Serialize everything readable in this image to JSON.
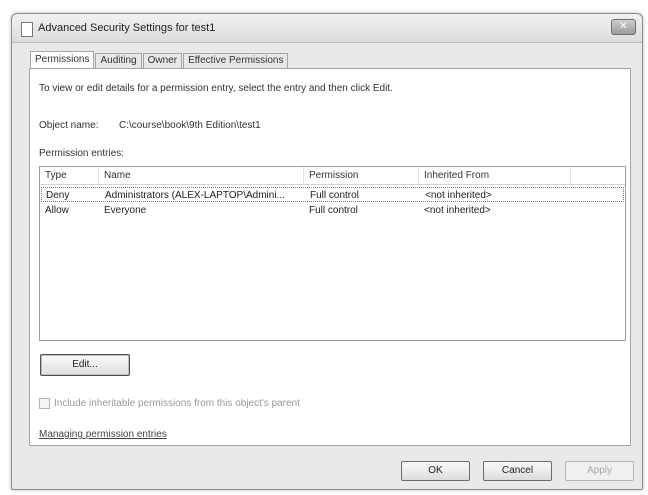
{
  "window": {
    "title": "Advanced Security Settings for test1",
    "close_glyph": "✕"
  },
  "tabs": [
    {
      "label": "Permissions",
      "active": true
    },
    {
      "label": "Auditing",
      "active": false
    },
    {
      "label": "Owner",
      "active": false
    },
    {
      "label": "Effective Permissions",
      "active": false
    }
  ],
  "panel": {
    "instructions": "To view or edit details for a permission entry, select the entry and then click Edit.",
    "object_name_label": "Object name:",
    "object_name_value": "C:\\course\\book\\9th Edition\\test1",
    "entries_label": "Permission entries:"
  },
  "permissions_table": {
    "columns": [
      "Type",
      "Name",
      "Permission",
      "Inherited From"
    ],
    "rows": [
      {
        "type": "Deny",
        "name": "Administrators (ALEX-LAPTOP\\Admini...",
        "permission": "Full control",
        "inherited_from": "<not inherited>",
        "selected": true
      },
      {
        "type": "Allow",
        "name": "Everyone",
        "permission": "Full control",
        "inherited_from": "<not inherited>",
        "selected": false
      }
    ]
  },
  "edit_button": "Edit...",
  "include_inheritable": {
    "label": "Include inheritable permissions from this object's parent",
    "checked": false,
    "enabled": false
  },
  "manage_link": "Managing permission entries",
  "footer_buttons": {
    "ok": "OK",
    "cancel": "Cancel",
    "apply": "Apply"
  },
  "icons": {
    "title_icon": "document-icon",
    "close_icon": "close-icon",
    "checkbox_icon": "checkbox-icon"
  }
}
